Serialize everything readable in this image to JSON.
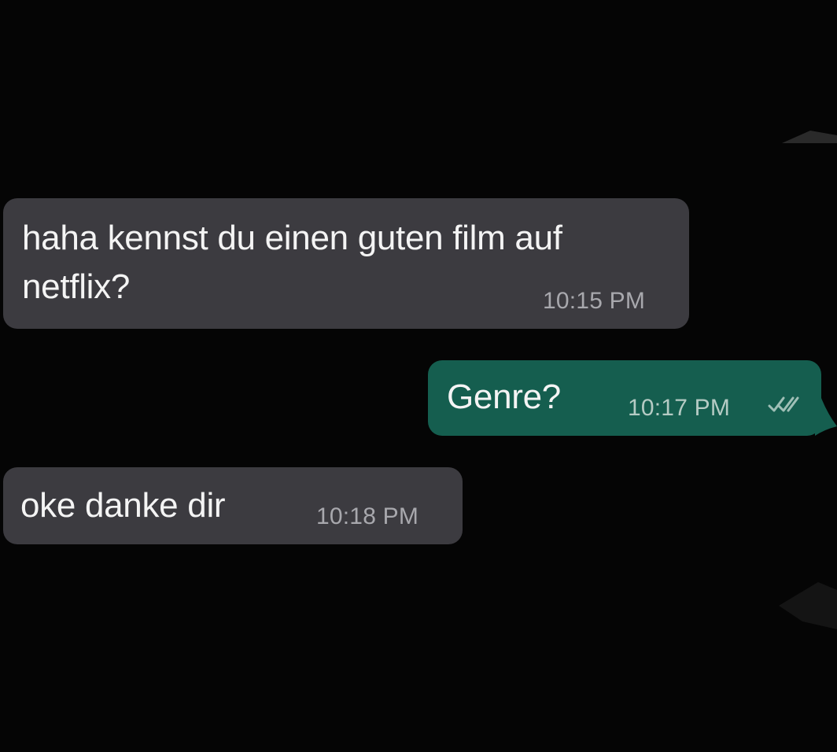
{
  "chat": {
    "messages": [
      {
        "direction": "incoming",
        "lines": [
          "haha kennst du einen guten film auf",
          "netflix?"
        ],
        "time": "10:15 PM"
      },
      {
        "direction": "outgoing",
        "lines": [
          "Genre?"
        ],
        "time": "10:17 PM",
        "status": "read",
        "status_icon": "double-check-icon"
      },
      {
        "direction": "incoming",
        "lines": [
          "oke danke dir"
        ],
        "time": "10:18 PM"
      }
    ]
  },
  "colors": {
    "background": "#050505",
    "incoming_bubble": "#3c3b40",
    "outgoing_bubble": "#155e4f",
    "text": "#f4f4f4",
    "timestamp": "#a8a8ad"
  }
}
